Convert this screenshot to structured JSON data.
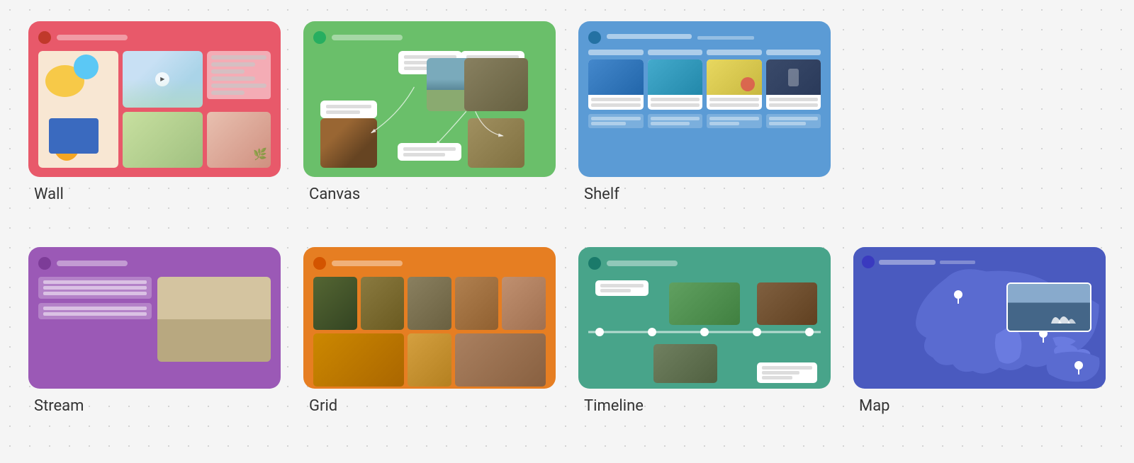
{
  "cards": [
    {
      "id": "wall",
      "label": "Wall",
      "bg_color": "#e8596a",
      "row": 1
    },
    {
      "id": "canvas",
      "label": "Canvas",
      "bg_color": "#6abf6a",
      "row": 1
    },
    {
      "id": "shelf",
      "label": "Shelf",
      "bg_color": "#5b9bd5",
      "row": 1
    },
    {
      "id": "stream",
      "label": "Stream",
      "bg_color": "#9b59b6",
      "row": 2
    },
    {
      "id": "grid",
      "label": "Grid",
      "bg_color": "#e67e22",
      "row": 2
    },
    {
      "id": "timeline",
      "label": "Timeline",
      "bg_color": "#48a48a",
      "row": 2
    },
    {
      "id": "map",
      "label": "Map",
      "bg_color": "#4a5abf",
      "row": 2
    }
  ]
}
